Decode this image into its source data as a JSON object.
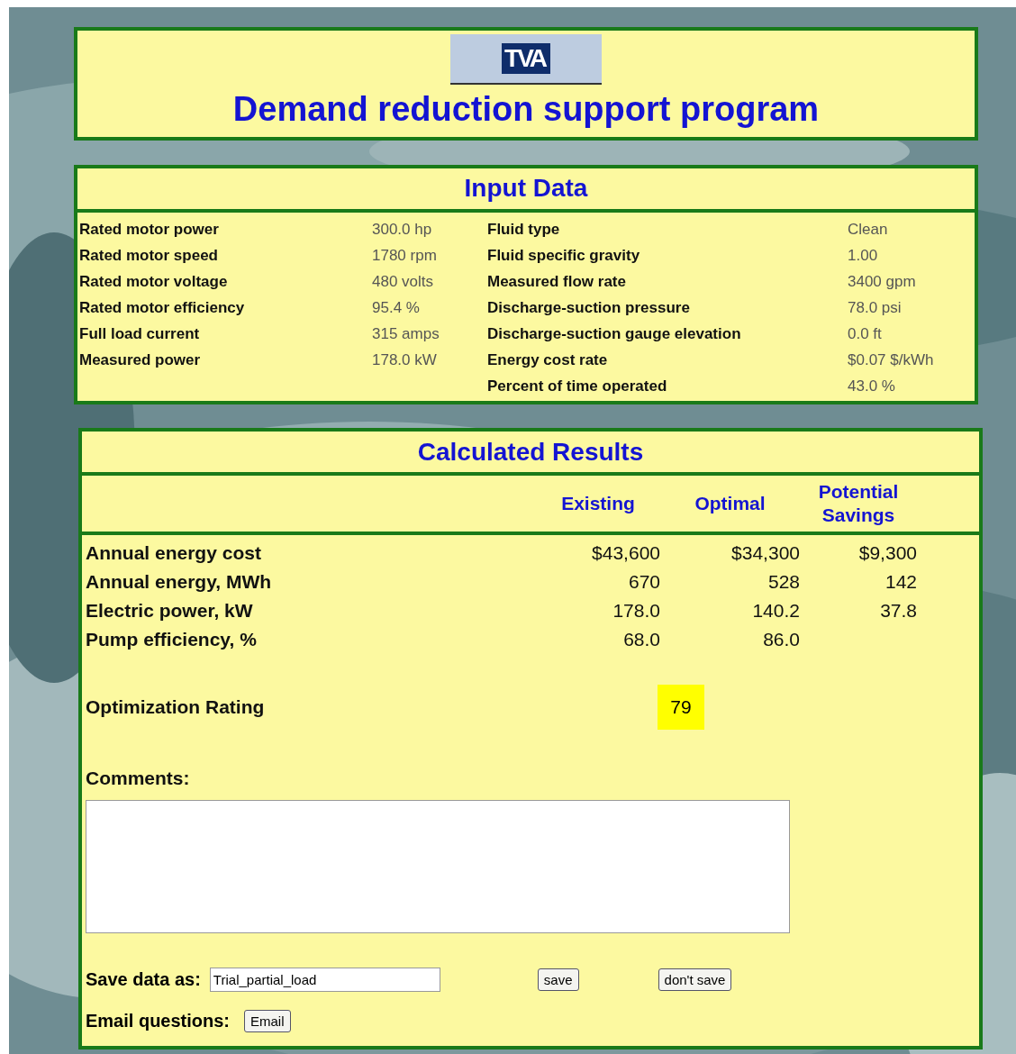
{
  "header": {
    "logo": "TVA",
    "title": "Demand reduction support program"
  },
  "input_data": {
    "title": "Input Data",
    "left": [
      {
        "label": "Rated motor power",
        "value": "300.0 hp"
      },
      {
        "label": "Rated motor speed",
        "value": "1780 rpm"
      },
      {
        "label": "Rated motor voltage",
        "value": "480 volts"
      },
      {
        "label": "Rated motor efficiency",
        "value": "95.4 %"
      },
      {
        "label": "Full load current",
        "value": "315 amps"
      },
      {
        "label": "Measured power",
        "value": "178.0 kW"
      }
    ],
    "right": [
      {
        "label": "Fluid type",
        "value": "Clean"
      },
      {
        "label": "Fluid specific gravity",
        "value": "1.00"
      },
      {
        "label": "Measured flow rate",
        "value": "3400 gpm"
      },
      {
        "label": "Discharge-suction pressure",
        "value": "78.0 psi"
      },
      {
        "label": "Discharge-suction gauge elevation",
        "value": "0.0 ft"
      },
      {
        "label": "Energy cost rate",
        "value": "$0.07 $/kWh"
      },
      {
        "label": "Percent of time operated",
        "value": "43.0 %"
      }
    ]
  },
  "results": {
    "title": "Calculated Results",
    "columns": [
      "Existing",
      "Optimal",
      "Potential Savings"
    ],
    "rows": [
      {
        "label": "Annual energy cost",
        "values": [
          "$43,600",
          "$34,300",
          "$9,300"
        ]
      },
      {
        "label": "Annual energy, MWh",
        "values": [
          "670",
          "528",
          "142"
        ]
      },
      {
        "label": "Electric power, kW",
        "values": [
          "178.0",
          "140.2",
          "37.8"
        ]
      },
      {
        "label": "Pump efficiency, %",
        "values": [
          "68.0",
          "86.0"
        ]
      }
    ],
    "rating": {
      "label": "Optimization Rating",
      "value": "79"
    },
    "comments": {
      "label": "Comments:"
    },
    "save": {
      "label": "Save data as:",
      "value": "Trial_partial_load",
      "buttons": [
        "save",
        "don't save"
      ]
    },
    "email": {
      "label": "Email questions:",
      "button": "Email"
    }
  }
}
